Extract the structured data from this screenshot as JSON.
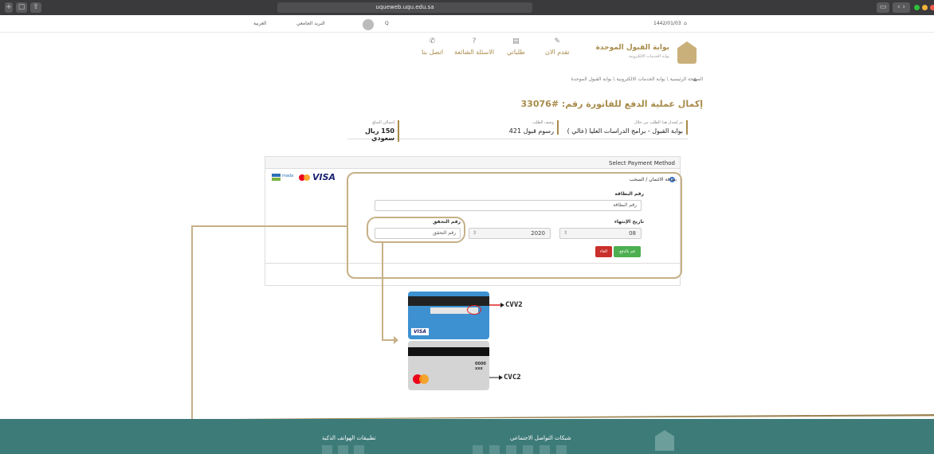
{
  "browser": {
    "url": "uqueweb.uqu.edu.sa"
  },
  "topbar": {
    "date": "1442/01/03",
    "language": "العربية",
    "mail": "البريد الجامعي",
    "search_hint": "Q"
  },
  "header": {
    "title": "بوابة القبول الموحدة",
    "subtitle": "بوابة الخدمات الالكترونية",
    "nav": [
      "تقدم الان",
      "طلباتي",
      "الاسئلة الشائعة",
      "اتصل بنا"
    ]
  },
  "breadcrumb": "الصفحة الرئيسية \\ بوابة الخدمات الالكترونية \\ بوابة القبول الموحدة",
  "invoice_title": "إكمال عملية الدفع للفاتورة رقم: #33076",
  "info": [
    {
      "label": "تم إصدار هذا الطلب من خلال",
      "value": "بوابة القبول - برامج الدراسات العليا (عالي )"
    },
    {
      "label": "وصف الطلب",
      "value": "رسوم قبول 421"
    },
    {
      "label": "إجمالي المبلغ",
      "value": "150 ريال سعودي"
    }
  ],
  "payment": {
    "heading": "Select Payment Method",
    "method": "بطاقة الائتمان / السحب",
    "card_number_label": "رقم البطاقة",
    "card_number_placeholder": "رقم البطاقة",
    "expiry_label": "تاريخ الإنتهاء",
    "expiry_month": "08",
    "expiry_year": "2020",
    "cvv_label": "رقم التحقق",
    "cvv_placeholder": "رقم التحقق",
    "pay_button": "قم بالدفع",
    "cancel_button": "الغاء",
    "brands": [
      "mada",
      "mastercard",
      "VISA"
    ]
  },
  "help": {
    "cvv2": "CVV2",
    "cvc2": "CVC2",
    "cvc_sample": "0000 xxx"
  },
  "footer": {
    "apps": "تطبيقات الهواتف الذكية",
    "social": "شبكات التواصل الاجتماعي"
  },
  "colors": {
    "gold": "#a88b4a",
    "teal": "#3d7b79",
    "green": "#4caf50",
    "red": "#c9302c"
  }
}
